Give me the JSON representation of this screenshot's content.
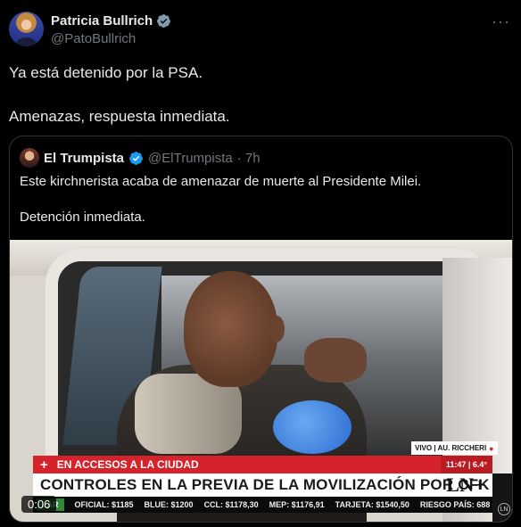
{
  "post": {
    "author": {
      "display_name": "Patricia Bullrich",
      "handle": "@PatoBullrich",
      "verified_icon": "verified-grey-badge-icon"
    },
    "text_line_1": "Ya está detenido por la PSA.",
    "text_line_2": "Amenazas, respuesta inmediata.",
    "more_label": "···"
  },
  "quote": {
    "author": {
      "display_name": "El Trumpista",
      "handle": "@ElTrumpista",
      "time": "· 7h",
      "verified_icon": "verified-blue-badge-icon"
    },
    "text_line_1": "Este kirchnerista acaba de amenazar de muerte al Presidente Milei.",
    "text_line_2": "Detención inmediata.",
    "video": {
      "duration": "0:06",
      "overlay": {
        "location": "VIVO | AU. RICCHERI",
        "banner_top": "EN ACCESOS A LA CIUDAD",
        "time": "11:47 | 6.4°",
        "headline": "CONTROLES EN LA PREVIA DE LA MOVILIZACIÓN POR CFK",
        "logo": "LN+",
        "ticker_label": "LAR",
        "ticker": [
          "OFICIAL: $1185",
          "BLUE: $1200",
          "CCL: $1178,30",
          "MEP: $1176,91",
          "TARJETA: $1540,50",
          "RIESGO PAÍS: 688"
        ]
      }
    }
  },
  "colors": {
    "background": "#000000",
    "text": "#e7e9ea",
    "muted": "#71767b",
    "blue_badge": "#1d9bf0",
    "grey_badge": "#829aab",
    "tv_red": "#d6222a"
  }
}
